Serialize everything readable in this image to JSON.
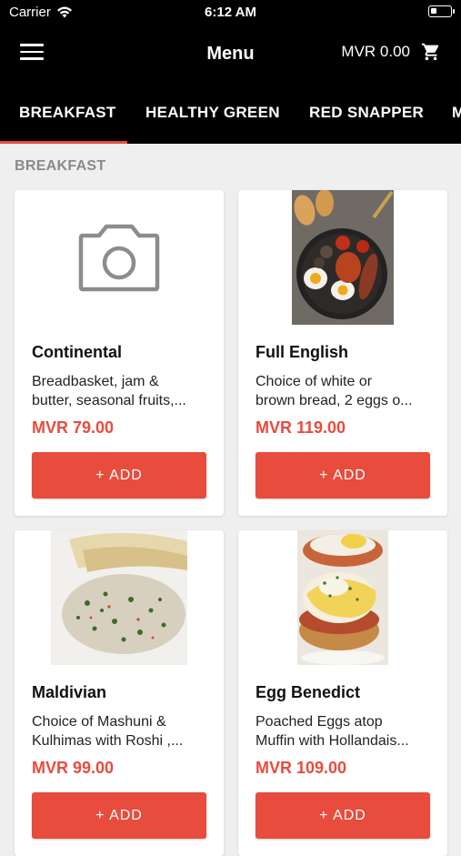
{
  "status_bar": {
    "carrier": "Carrier",
    "time": "6:12 AM"
  },
  "nav": {
    "title": "Menu",
    "cart_total": "MVR 0.00"
  },
  "tabs": [
    "BREAKFAST",
    "HEALTHY GREEN",
    "RED SNAPPER",
    "M"
  ],
  "section_title": "BREAKFAST",
  "items": [
    {
      "name": "Continental",
      "desc_line1": "Breadbasket, jam &",
      "desc_line2": "butter, seasonal fruits,...",
      "price": "MVR 79.00",
      "button": "+ ADD",
      "image": "camera-placeholder-icon"
    },
    {
      "name": "Full English",
      "desc_line1": "Choice of white or",
      "desc_line2": "brown bread, 2 eggs o...",
      "price": "MVR 119.00",
      "button": "+ ADD",
      "image": "full-english-photo"
    },
    {
      "name": "Maldivian",
      "desc_line1": "Choice of Mashuni &",
      "desc_line2": "Kulhimas with Roshi ,...",
      "price": "MVR 99.00",
      "button": "+ ADD",
      "image": "maldivian-photo"
    },
    {
      "name": "Egg Benedict",
      "desc_line1": "Poached Eggs atop",
      "desc_line2": "Muffin with Hollandais...",
      "price": "MVR 109.00",
      "button": "+ ADD",
      "image": "egg-benedict-photo"
    }
  ],
  "colors": {
    "accent": "#e74c3c",
    "header": "#000000",
    "background": "#efefef"
  }
}
